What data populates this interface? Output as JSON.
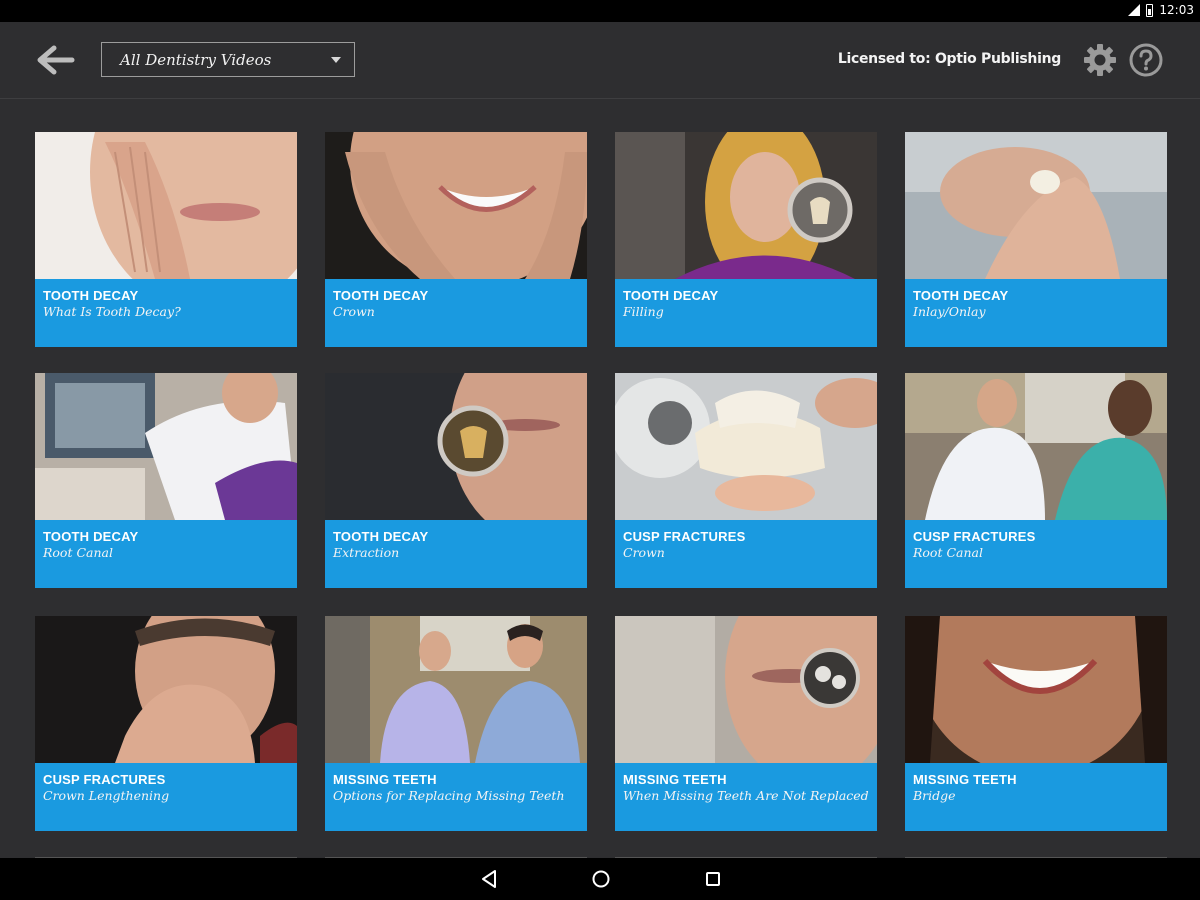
{
  "status_bar": {
    "time": "12:03"
  },
  "toolbar": {
    "filter_selected": "All Dentistry Videos",
    "licensed_text": "Licensed to: Optio Publishing"
  },
  "videos": [
    {
      "category": "TOOTH DECAY",
      "title": "What Is Tooth Decay?"
    },
    {
      "category": "TOOTH DECAY",
      "title": "Crown"
    },
    {
      "category": "TOOTH DECAY",
      "title": "Filling"
    },
    {
      "category": "TOOTH DECAY",
      "title": "Inlay/Onlay"
    },
    {
      "category": "TOOTH DECAY",
      "title": "Root Canal"
    },
    {
      "category": "TOOTH DECAY",
      "title": "Extraction"
    },
    {
      "category": "CUSP FRACTURES",
      "title": "Crown"
    },
    {
      "category": "CUSP FRACTURES",
      "title": "Root Canal"
    },
    {
      "category": "CUSP FRACTURES",
      "title": "Crown Lengthening"
    },
    {
      "category": "MISSING TEETH",
      "title": "Options for Replacing Missing Teeth"
    },
    {
      "category": "MISSING TEETH",
      "title": "When Missing Teeth Are Not Replaced"
    },
    {
      "category": "MISSING TEETH",
      "title": "Bridge"
    }
  ],
  "colors": {
    "caption_blue": "#1a9ae0",
    "app_background": "#2e2e30",
    "skin": "#d9a98e"
  },
  "icons": [
    "back-arrow-icon",
    "dropdown-caret-icon",
    "gear-icon",
    "help-icon",
    "nav-back-icon",
    "nav-home-icon",
    "nav-recents-icon"
  ]
}
